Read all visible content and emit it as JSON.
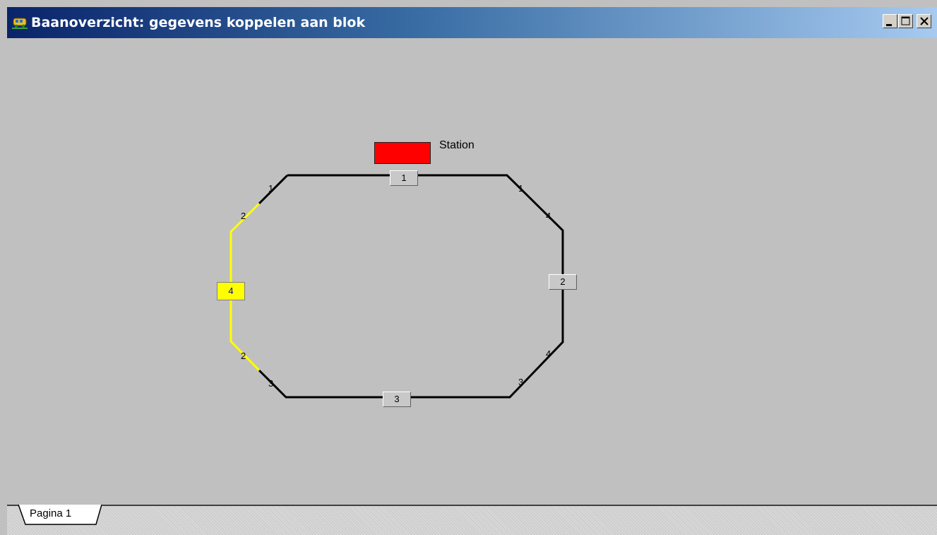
{
  "window": {
    "title": "Baanoverzicht: gegevens koppelen aan blok",
    "controls": {
      "minimize": "minimize-icon",
      "maximize": "maximize-icon",
      "close": "close-icon"
    }
  },
  "layout": {
    "station_label": "Station",
    "blocks": [
      {
        "id": "1",
        "label": "1",
        "selected": false
      },
      {
        "id": "2",
        "label": "2",
        "selected": false
      },
      {
        "id": "3",
        "label": "3",
        "selected": false
      },
      {
        "id": "4",
        "label": "4",
        "selected": true
      }
    ],
    "contacts": {
      "top_left_1": "1",
      "top_left_2": "2",
      "top_right_1": "1",
      "top_right_4": "4",
      "bottom_left_2": "2",
      "bottom_left_3": "3",
      "bottom_right_4": "4",
      "bottom_right_3": "3"
    },
    "colors": {
      "track": "#000000",
      "track_selected": "#ffff00",
      "station": "#ff0000",
      "block_selected": "#ffff00",
      "background": "#c0c0c0"
    }
  },
  "tabs": [
    {
      "label": "Pagina 1",
      "active": true
    }
  ]
}
